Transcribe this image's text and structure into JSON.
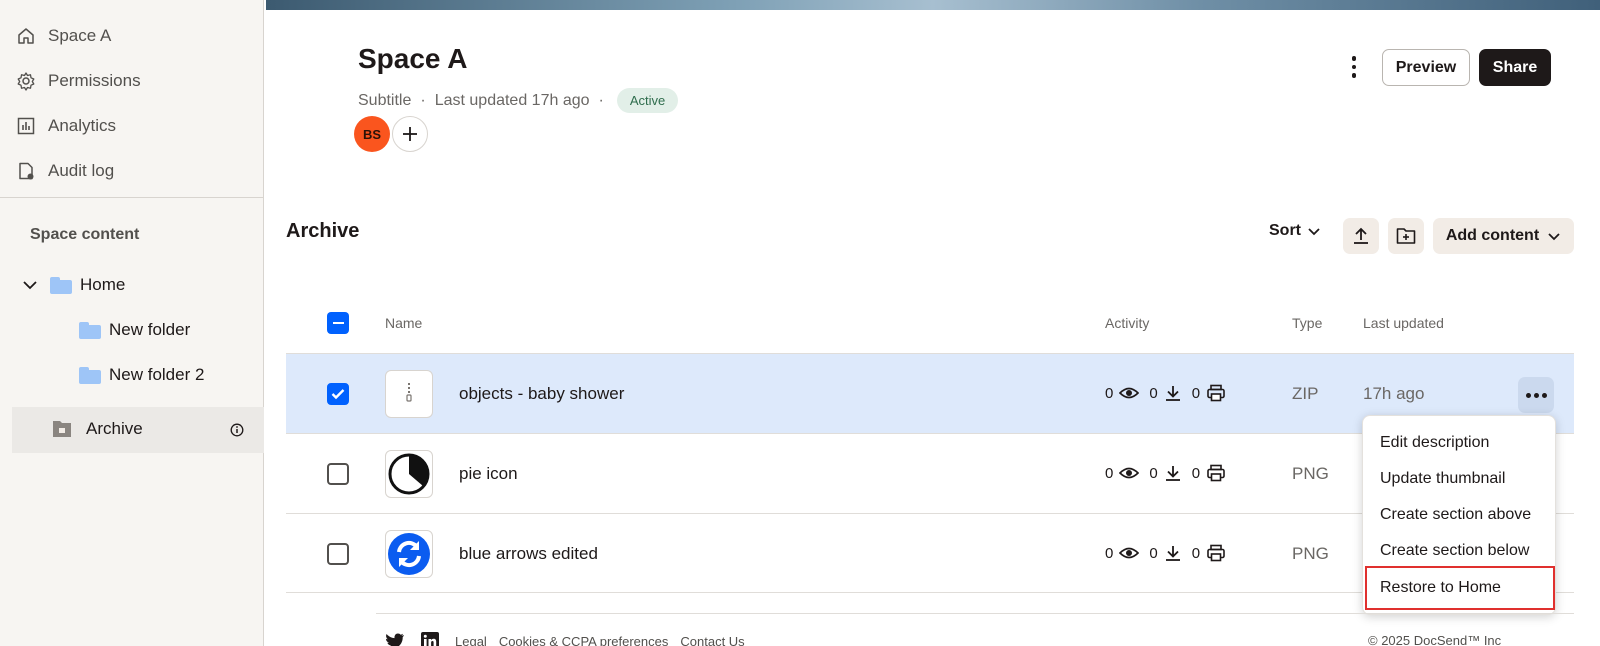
{
  "sidebar": {
    "nav": [
      {
        "label": "Space A",
        "icon": "home-icon"
      },
      {
        "label": "Permissions",
        "icon": "gear-icon"
      },
      {
        "label": "Analytics",
        "icon": "analytics-icon"
      },
      {
        "label": "Audit log",
        "icon": "audit-log-icon"
      }
    ],
    "section_heading": "Space content",
    "tree": {
      "home": "Home",
      "folder1": "New folder",
      "folder2": "New folder 2",
      "archive": "Archive"
    }
  },
  "header": {
    "title": "Space A",
    "subtitle": "Subtitle",
    "separator": "·",
    "last_updated": "Last updated 17h ago",
    "status": "Active",
    "avatar_initials": "BS",
    "preview_label": "Preview",
    "share_label": "Share"
  },
  "section": {
    "title": "Archive",
    "sort_label": "Sort",
    "add_content_label": "Add content"
  },
  "table": {
    "columns": {
      "name": "Name",
      "activity": "Activity",
      "type": "Type",
      "last_updated": "Last updated"
    },
    "rows": [
      {
        "name": "objects - baby shower",
        "views": "0",
        "downloads": "0",
        "prints": "0",
        "type": "ZIP",
        "updated": "17h ago",
        "selected": true
      },
      {
        "name": "pie icon",
        "views": "0",
        "downloads": "0",
        "prints": "0",
        "type": "PNG",
        "updated": "",
        "selected": false
      },
      {
        "name": "blue arrows edited",
        "views": "0",
        "downloads": "0",
        "prints": "0",
        "type": "PNG",
        "updated": "",
        "selected": false
      }
    ]
  },
  "context_menu": {
    "items": [
      "Edit description",
      "Update thumbnail",
      "Create section above",
      "Create section below",
      "Restore to Home"
    ]
  },
  "footer": {
    "links": [
      "Legal",
      "Cookies & CCPA preferences",
      "Contact Us"
    ],
    "copyright": "© 2025 DocSend™ Inc"
  },
  "colors": {
    "accent": "#0061fe",
    "selected_row": "#dde9fb",
    "avatar": "#fa551e",
    "status_badge": "#e2efe8",
    "highlight_outline": "#e0302e"
  }
}
